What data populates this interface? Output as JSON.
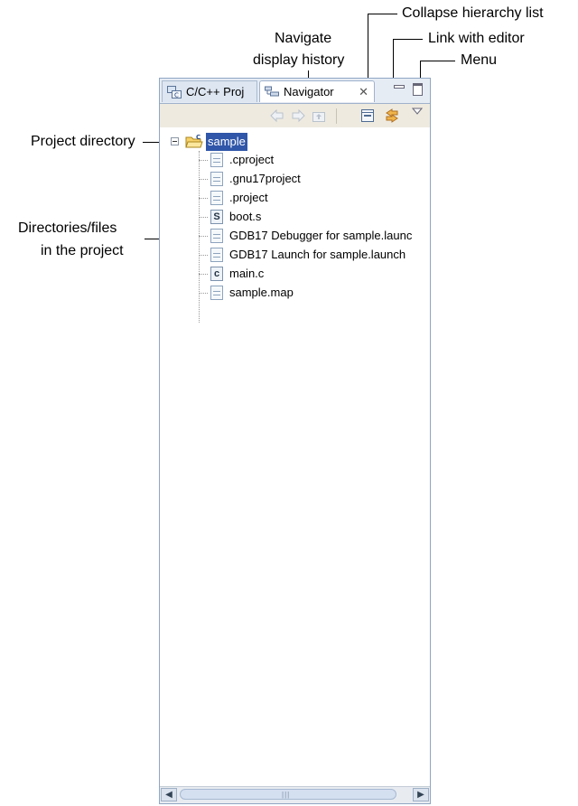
{
  "annotations": {
    "collapse_hierarchy": "Collapse hierarchy list",
    "link_with_editor": "Link with editor",
    "navigate_history_1": "Navigate",
    "navigate_history_2": "display history",
    "menu": "Menu",
    "project_directory": "Project directory",
    "dirs_files_1": "Directories/files",
    "dirs_files_2": "in the project"
  },
  "tabs": [
    {
      "label": "C/C++ Proj",
      "active": false,
      "icon": "cpp-projects-icon"
    },
    {
      "label": "Navigator",
      "active": true,
      "icon": "navigator-icon"
    }
  ],
  "toolbar": {
    "icons": [
      "back-arrow-icon",
      "forward-arrow-icon",
      "up-folder-icon",
      "collapse-all-icon",
      "link-with-editor-icon",
      "view-menu-icon"
    ]
  },
  "tree": {
    "root": {
      "label": "sample",
      "icon": "project-folder-icon",
      "expanded": true
    },
    "items": [
      {
        "label": ".cproject",
        "icon": "text-file-icon"
      },
      {
        "label": ".gnu17project",
        "icon": "text-file-icon"
      },
      {
        "label": ".project",
        "icon": "text-file-icon"
      },
      {
        "label": "boot.s",
        "icon": "asm-file-icon"
      },
      {
        "label": "GDB17 Debugger for sample.launc",
        "icon": "text-file-icon"
      },
      {
        "label": "GDB17 Launch for sample.launch",
        "icon": "text-file-icon"
      },
      {
        "label": "main.c",
        "icon": "c-file-icon"
      },
      {
        "label": "sample.map",
        "icon": "text-file-icon"
      }
    ]
  },
  "colors": {
    "selection": "#2f56a8",
    "panel_border": "#8fa6c2",
    "toolbar_bg": "#eeeae0"
  }
}
